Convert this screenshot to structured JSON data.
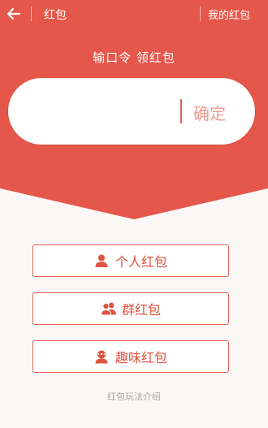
{
  "header": {
    "back_icon": "arrow-left-icon",
    "title": "红包",
    "my_link": "我的红包"
  },
  "hero": {
    "prompt": "输口令 领红包",
    "input_value": "",
    "confirm_label": "确定"
  },
  "buttons": [
    {
      "label": "个人红包",
      "icon": "person-icon"
    },
    {
      "label": "群红包",
      "icon": "group-icon"
    },
    {
      "label": "趣味红包",
      "icon": "fun-face-icon"
    }
  ],
  "footer": {
    "rules_link": "红包玩法介绍"
  },
  "colors": {
    "brand_red": "#e5574a",
    "button_text": "#de5341",
    "placeholder_confirm": "#ea9b8e"
  }
}
